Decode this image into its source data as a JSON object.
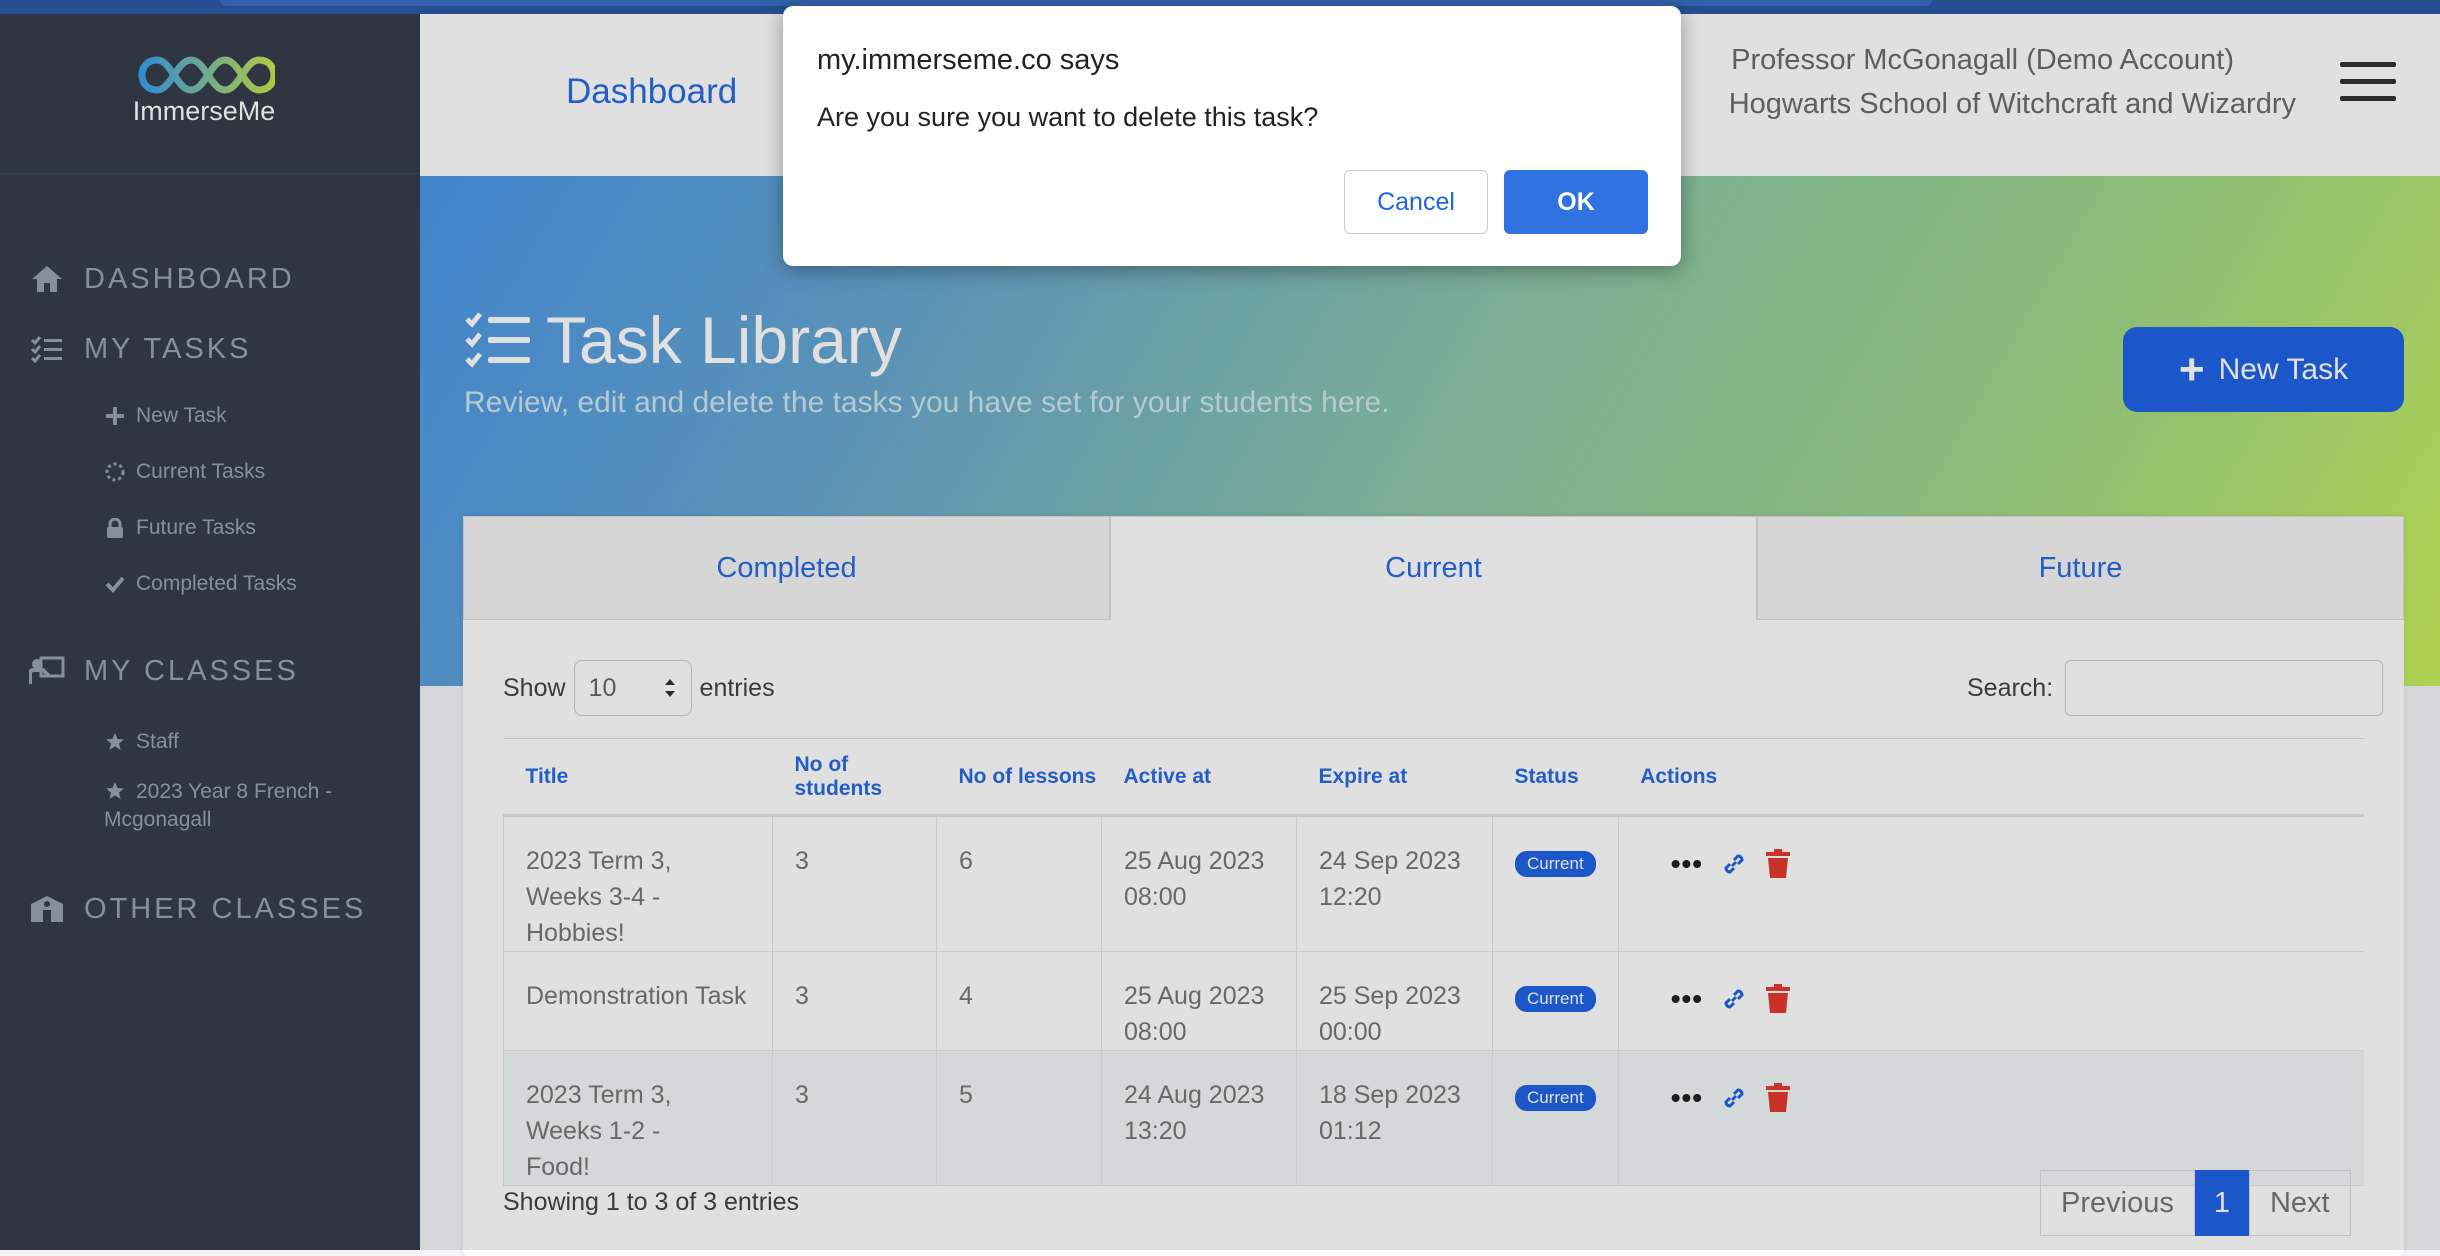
{
  "app": {
    "logo_text": "ImmerseMe"
  },
  "sidebar": {
    "sections": [
      {
        "label": "DASHBOARD",
        "icon": "home-icon"
      },
      {
        "label": "MY TASKS",
        "icon": "tasks-list-icon"
      },
      {
        "label": "MY CLASSES",
        "icon": "teacher-board-icon"
      },
      {
        "label": "OTHER CLASSES",
        "icon": "school-building-icon"
      }
    ],
    "task_items": [
      {
        "label": "New Task",
        "icon": "plus-icon"
      },
      {
        "label": "Current Tasks",
        "icon": "spinner-icon"
      },
      {
        "label": "Future Tasks",
        "icon": "lock-icon"
      },
      {
        "label": "Completed Tasks",
        "icon": "check-icon"
      }
    ],
    "class_items": [
      {
        "label": "Staff",
        "icon": "star-icon"
      },
      {
        "label": "2023 Year 8 French -",
        "label2": "Mcgonagall",
        "icon": "star-icon"
      }
    ]
  },
  "header": {
    "dashboard_link": "Dashboard",
    "user_name": "Professor McGonagall (Demo Account)",
    "school": "Hogwarts School of Witchcraft and Wizardry"
  },
  "hero": {
    "title": "Task Library",
    "subtitle": "Review, edit and delete the tasks you have set for your students here.",
    "new_task_button": "New Task"
  },
  "tabs": [
    "Completed",
    "Current",
    "Future"
  ],
  "table_controls": {
    "show_label": "Show",
    "entries_value": "10",
    "entries_label": "entries",
    "search_label": "Search:"
  },
  "table": {
    "headers": [
      "Title",
      "No of students",
      "No of lessons",
      "Active at",
      "Expire at",
      "Status",
      "Actions"
    ],
    "rows": [
      {
        "title1": "2023 Term 3, Weeks 3-4 -",
        "title2": "Hobbies!",
        "students": "3",
        "lessons": "6",
        "active": "25 Aug 2023 08:00",
        "expire": "24 Sep 2023 12:20",
        "status": "Current"
      },
      {
        "title1": "Demonstration Task",
        "title2": "",
        "students": "3",
        "lessons": "4",
        "active": "25 Aug 2023 08:00",
        "expire": "25 Sep 2023 00:00",
        "status": "Current"
      },
      {
        "title1": "2023 Term 3, Weeks 1-2 -",
        "title2": "Food!",
        "students": "3",
        "lessons": "5",
        "active": "24 Aug 2023 13:20",
        "expire": "18 Sep 2023 01:12",
        "status": "Current"
      }
    ]
  },
  "footer": {
    "info": "Showing 1 to 3 of 3 entries",
    "pager": {
      "previous": "Previous",
      "current": "1",
      "next": "Next"
    }
  },
  "dialog": {
    "title": "my.immerseme.co says",
    "message": "Are you sure you want to delete this task?",
    "cancel": "Cancel",
    "ok": "OK"
  },
  "colors": {
    "accent": "#1f64e4",
    "sidebar": "#363e4b",
    "delete": "#e53a2f"
  }
}
